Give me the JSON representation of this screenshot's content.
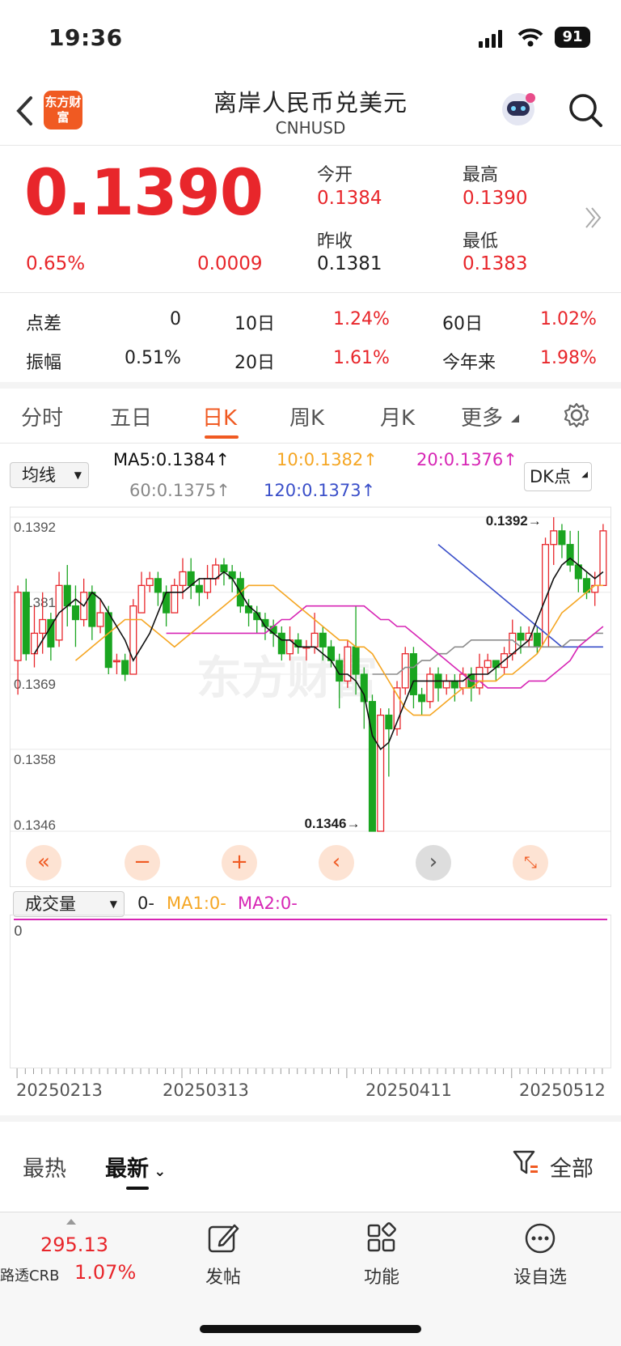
{
  "status_bar": {
    "time": "19:36",
    "battery": "91"
  },
  "header": {
    "logo_text": "东方财富",
    "title": "离岸人民币兑美元",
    "symbol": "CNHUSD",
    "icons": [
      "back-arrow-icon",
      "assistant-robot-icon",
      "search-icon"
    ]
  },
  "quote": {
    "price": "0.1390",
    "change_pct": "0.65%",
    "change": "0.0009",
    "open_label": "今开",
    "open": "0.1384",
    "high_label": "最高",
    "high": "0.1390",
    "prev_close_label": "昨收",
    "prev_close": "0.1381",
    "low_label": "最低",
    "low": "0.1383"
  },
  "stats": {
    "spread_label": "点差",
    "spread": "0",
    "d10_label": "10日",
    "d10": "1.24%",
    "d60_label": "60日",
    "d60": "1.02%",
    "amp_label": "振幅",
    "amp": "0.51%",
    "d20_label": "20日",
    "d20": "1.61%",
    "ytd_label": "今年来",
    "ytd": "1.98%"
  },
  "tabs": [
    "分时",
    "五日",
    "日K",
    "周K",
    "月K",
    "更多"
  ],
  "active_tab": "日K",
  "ma": {
    "selector": "均线",
    "ma5": "MA5:0.1384",
    "ma10": "10:0.1382",
    "ma20": "20:0.1376",
    "ma60": "60:0.1375",
    "ma120": "120:0.1373",
    "dk_button": "DK点"
  },
  "colors": {
    "up": "#e8262b",
    "down": "#1aa520",
    "ma5": "#111111",
    "ma10": "#f5a623",
    "ma20": "#d726b5",
    "ma60": "#8c8c8c",
    "ma120": "#3a4fc9",
    "accent": "#f05a22"
  },
  "chart_data": {
    "type": "candlestick",
    "y_ticks": [
      "0.1392",
      "0.1381",
      "0.1369",
      "0.1358",
      "0.1346"
    ],
    "ylim": [
      0.1346,
      0.1392
    ],
    "max_label": "0.1392",
    "min_label": "0.1346",
    "x_labels": [
      "20250213",
      "20250313",
      "20250411",
      "20250512"
    ],
    "candles": [
      [
        0.1371,
        0.1381,
        0.1366,
        0.1382
      ],
      [
        0.1381,
        0.1372,
        0.1371,
        0.1383
      ],
      [
        0.1372,
        0.1375,
        0.137,
        0.1379
      ],
      [
        0.1375,
        0.1377,
        0.1372,
        0.1381
      ],
      [
        0.1377,
        0.1373,
        0.1371,
        0.1378
      ],
      [
        0.1374,
        0.1382,
        0.1373,
        0.1384
      ],
      [
        0.1382,
        0.1379,
        0.1376,
        0.1385
      ],
      [
        0.1379,
        0.1377,
        0.1373,
        0.1382
      ],
      [
        0.1377,
        0.1381,
        0.1376,
        0.1383
      ],
      [
        0.1381,
        0.1376,
        0.1374,
        0.1382
      ],
      [
        0.1376,
        0.1378,
        0.1375,
        0.138
      ],
      [
        0.1378,
        0.137,
        0.1369,
        0.1379
      ],
      [
        0.1371,
        0.1371,
        0.1369,
        0.1372
      ],
      [
        0.1371,
        0.1369,
        0.1368,
        0.1372
      ],
      [
        0.1369,
        0.1379,
        0.1369,
        0.138
      ],
      [
        0.1378,
        0.1382,
        0.1378,
        0.1384
      ],
      [
        0.1382,
        0.1383,
        0.1381,
        0.1384
      ],
      [
        0.1383,
        0.1381,
        0.1379,
        0.1384
      ],
      [
        0.1381,
        0.1378,
        0.1376,
        0.1382
      ],
      [
        0.1378,
        0.1382,
        0.1378,
        0.1383
      ],
      [
        0.1382,
        0.1384,
        0.138,
        0.1386
      ],
      [
        0.1384,
        0.1382,
        0.138,
        0.1386
      ],
      [
        0.1382,
        0.1381,
        0.1379,
        0.1383
      ],
      [
        0.1381,
        0.1383,
        0.138,
        0.1385
      ],
      [
        0.1383,
        0.1385,
        0.1382,
        0.1386
      ],
      [
        0.1385,
        0.1384,
        0.1382,
        0.1386
      ],
      [
        0.1384,
        0.1383,
        0.1381,
        0.1385
      ],
      [
        0.1383,
        0.1379,
        0.1378,
        0.1384
      ],
      [
        0.1379,
        0.1378,
        0.1376,
        0.138
      ],
      [
        0.1378,
        0.1377,
        0.1375,
        0.1379
      ],
      [
        0.1377,
        0.1376,
        0.1374,
        0.1378
      ],
      [
        0.1376,
        0.1375,
        0.1373,
        0.1377
      ],
      [
        0.1375,
        0.1372,
        0.1371,
        0.1376
      ],
      [
        0.1372,
        0.1374,
        0.1371,
        0.1376
      ],
      [
        0.1374,
        0.1373,
        0.1372,
        0.1375
      ],
      [
        0.1373,
        0.1373,
        0.1371,
        0.1374
      ],
      [
        0.1373,
        0.1375,
        0.1372,
        0.1378
      ],
      [
        0.1375,
        0.1373,
        0.1371,
        0.1376
      ],
      [
        0.1373,
        0.1371,
        0.137,
        0.1374
      ],
      [
        0.1371,
        0.1368,
        0.1364,
        0.1372
      ],
      [
        0.1368,
        0.1373,
        0.1367,
        0.1374
      ],
      [
        0.1373,
        0.1369,
        0.1366,
        0.1379
      ],
      [
        0.1369,
        0.1365,
        0.1361,
        0.137
      ],
      [
        0.1365,
        0.1346,
        0.1346,
        0.1366
      ],
      [
        0.1346,
        0.1363,
        0.1346,
        0.1364
      ],
      [
        0.1363,
        0.1361,
        0.1354,
        0.1364
      ],
      [
        0.1361,
        0.1367,
        0.136,
        0.1368
      ],
      [
        0.1367,
        0.1372,
        0.1366,
        0.1373
      ],
      [
        0.1372,
        0.1366,
        0.1364,
        0.1373
      ],
      [
        0.1366,
        0.1365,
        0.1363,
        0.1367
      ],
      [
        0.1365,
        0.1369,
        0.1364,
        0.137
      ],
      [
        0.1369,
        0.1367,
        0.1365,
        0.137
      ],
      [
        0.1367,
        0.1368,
        0.1366,
        0.1369
      ],
      [
        0.1368,
        0.1367,
        0.1365,
        0.1369
      ],
      [
        0.1367,
        0.1369,
        0.1366,
        0.137
      ],
      [
        0.1369,
        0.1367,
        0.1365,
        0.137
      ],
      [
        0.1367,
        0.137,
        0.1366,
        0.1372
      ],
      [
        0.137,
        0.1371,
        0.1369,
        0.1372
      ],
      [
        0.1371,
        0.137,
        0.1368,
        0.1371
      ],
      [
        0.137,
        0.1372,
        0.1369,
        0.1373
      ],
      [
        0.1372,
        0.1375,
        0.1371,
        0.1377
      ],
      [
        0.1375,
        0.1374,
        0.1372,
        0.1376
      ],
      [
        0.1374,
        0.1375,
        0.1373,
        0.1376
      ],
      [
        0.1375,
        0.1373,
        0.1372,
        0.1376
      ],
      [
        0.1373,
        0.1388,
        0.1373,
        0.1389
      ],
      [
        0.1388,
        0.139,
        0.1385,
        0.1392
      ],
      [
        0.139,
        0.1388,
        0.1386,
        0.1391
      ],
      [
        0.1388,
        0.1385,
        0.1384,
        0.139
      ],
      [
        0.1385,
        0.1383,
        0.1381,
        0.139
      ],
      [
        0.1383,
        0.1381,
        0.138,
        0.1384
      ],
      [
        0.1381,
        0.1382,
        0.1379,
        0.1384
      ],
      [
        0.1382,
        0.139,
        0.1382,
        0.1391
      ]
    ],
    "ma5": [
      0.1372,
      0.1374,
      0.1376,
      0.1378,
      0.1379,
      0.138,
      0.1379,
      0.1381,
      0.138,
      0.1378,
      0.1376,
      0.1374,
      0.1371,
      0.1373,
      0.1375,
      0.1378,
      0.1381,
      0.1381,
      0.1381,
      0.1382,
      0.1383,
      0.1383,
      0.1383,
      0.1384,
      0.1383,
      0.1381,
      0.1379,
      0.1378,
      0.1376,
      0.1375,
      0.1374,
      0.1374,
      0.1373,
      0.1373,
      0.1373,
      0.1372,
      0.1371,
      0.1369,
      0.1369,
      0.1368,
      0.1366,
      0.136,
      0.1358,
      0.1359,
      0.1362,
      0.1365,
      0.1368,
      0.1368,
      0.1368,
      0.1368,
      0.1368,
      0.1368,
      0.1368,
      0.1369,
      0.1369,
      0.1369,
      0.137,
      0.1371,
      0.1372,
      0.1373,
      0.1374,
      0.1377,
      0.138,
      0.1383,
      0.1385,
      0.1386,
      0.1385,
      0.1384,
      0.1383,
      0.1384
    ],
    "ma10": [
      0.1371,
      0.1372,
      0.1373,
      0.1374,
      0.1375,
      0.1376,
      0.1377,
      0.1377,
      0.1377,
      0.1376,
      0.1375,
      0.1374,
      0.1373,
      0.1374,
      0.1375,
      0.1376,
      0.1377,
      0.1378,
      0.1379,
      0.138,
      0.1381,
      0.1382,
      0.1382,
      0.1382,
      0.1382,
      0.1381,
      0.138,
      0.1379,
      0.1378,
      0.1377,
      0.1376,
      0.1375,
      0.1374,
      0.1374,
      0.1373,
      0.1373,
      0.1372,
      0.137,
      0.1368,
      0.1366,
      0.1364,
      0.1363,
      0.1363,
      0.1363,
      0.1364,
      0.1365,
      0.1366,
      0.1367,
      0.1367,
      0.1368,
      0.1368,
      0.1368,
      0.1369,
      0.1369,
      0.137,
      0.1371,
      0.1372,
      0.1374,
      0.1376,
      0.1378,
      0.1379,
      0.138,
      0.1381,
      0.1382,
      0.1382
    ],
    "ma20": [
      0.1375,
      0.1375,
      0.1375,
      0.1375,
      0.1375,
      0.1375,
      0.1375,
      0.1375,
      0.1375,
      0.1375,
      0.1375,
      0.1375,
      0.1375,
      0.1376,
      0.1377,
      0.1377,
      0.1378,
      0.1379,
      0.1379,
      0.1379,
      0.1379,
      0.1379,
      0.1379,
      0.1379,
      0.1379,
      0.1378,
      0.1377,
      0.1377,
      0.1376,
      0.1376,
      0.1375,
      0.1374,
      0.1373,
      0.1372,
      0.1371,
      0.137,
      0.1369,
      0.1368,
      0.1368,
      0.1367,
      0.1367,
      0.1367,
      0.1367,
      0.1367,
      0.1368,
      0.1368,
      0.1368,
      0.1369,
      0.137,
      0.1371,
      0.1373,
      0.1374,
      0.1375,
      0.1376
    ],
    "ma60": [
      0.1369,
      0.1369,
      0.1369,
      0.1369,
      0.137,
      0.137,
      0.1371,
      0.1371,
      0.1372,
      0.1372,
      0.1373,
      0.1373,
      0.1374,
      0.1374,
      0.1374,
      0.1374,
      0.1374,
      0.1374,
      0.1373,
      0.1373,
      0.1373,
      0.1373,
      0.1373,
      0.1373,
      0.1374,
      0.1374,
      0.1374,
      0.1375,
      0.1375
    ],
    "ma120": [
      0.1388,
      0.1387,
      0.1386,
      0.1385,
      0.1384,
      0.1383,
      0.1382,
      0.1381,
      0.138,
      0.1379,
      0.1378,
      0.1377,
      0.1376,
      0.1375,
      0.1374,
      0.1373,
      0.1373,
      0.1373,
      0.1373,
      0.1373,
      0.1373
    ]
  },
  "volume": {
    "selector": "成交量",
    "value": "0-",
    "ma1": "MA1:0-",
    "ma2": "MA2:0-",
    "axis_zero": "0"
  },
  "news_tabs": {
    "hot": "最热",
    "latest": "最新",
    "filter": "全部"
  },
  "bottom_nav": {
    "index_value": "295.13",
    "index_name": "路透CRB",
    "index_change": "1.07%",
    "post": "发帖",
    "functions": "功能",
    "set_watch": "设自选"
  },
  "watermark": "东方财富"
}
